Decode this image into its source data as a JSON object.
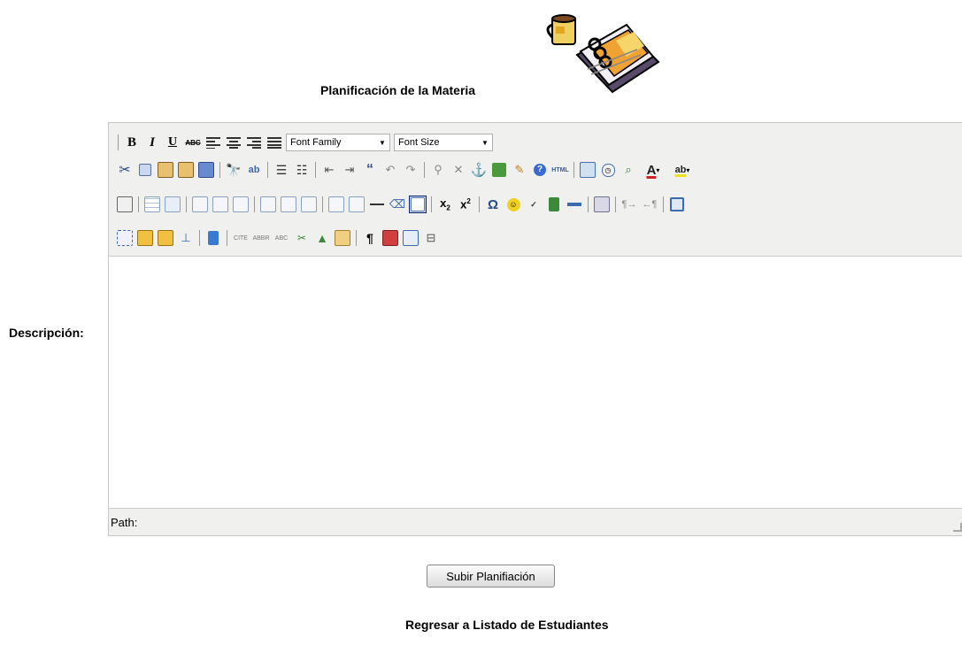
{
  "page": {
    "title": "Planificación de la Materia",
    "description_label": "Descripción:",
    "submit_label": "Subir Planifiación",
    "back_link": "Regresar a Listado de Estudiantes"
  },
  "editor": {
    "font_family_label": "Font Family",
    "font_size_label": "Font Size",
    "path_label": "Path:",
    "toolbar_icons": {
      "row1": [
        "bold-icon",
        "italic-icon",
        "underline-icon",
        "strikethrough-icon",
        "align-left-icon",
        "align-center-icon",
        "align-right-icon",
        "align-justify-icon"
      ],
      "row2": [
        "cut-icon",
        "copy-icon",
        "paste-icon",
        "paste-text-icon",
        "paste-word-icon",
        "find-icon",
        "replace-icon",
        "bullet-list-icon",
        "numbered-list-icon",
        "outdent-icon",
        "indent-icon",
        "blockquote-icon",
        "undo-icon",
        "redo-icon",
        "link-icon",
        "unlink-icon",
        "anchor-icon",
        "image-icon",
        "cleanup-icon",
        "help-icon",
        "html-icon",
        "insert-date-icon",
        "insert-time-icon",
        "preview-icon",
        "text-color-icon",
        "background-color-icon"
      ],
      "row3": [
        "edit-icon",
        "table-icon",
        "row-props-icon",
        "cell-props-icon",
        "insert-row-before-icon",
        "insert-row-after-icon",
        "delete-row-icon",
        "insert-col-before-icon",
        "insert-col-after-icon",
        "delete-col-icon",
        "split-cells-icon",
        "merge-cells-icon",
        "horizontal-rule-icon",
        "remove-format-icon",
        "visual-aid-icon",
        "subscript-icon",
        "superscript-icon",
        "charmap-icon",
        "emotions-icon",
        "spellcheck-icon",
        "media-icon",
        "advhr-icon",
        "print-icon",
        "ltr-icon",
        "rtl-icon",
        "fullscreen-icon"
      ],
      "row4": [
        "insert-layer-icon",
        "move-forward-icon",
        "move-backward-icon",
        "absolute-icon",
        "style-props-icon",
        "cite-icon",
        "abbr-icon",
        "acronym-icon",
        "del-icon",
        "ins-icon",
        "attribs-icon",
        "visual-chars-icon",
        "non-breaking-icon",
        "template-icon",
        "page-break-icon"
      ]
    }
  }
}
